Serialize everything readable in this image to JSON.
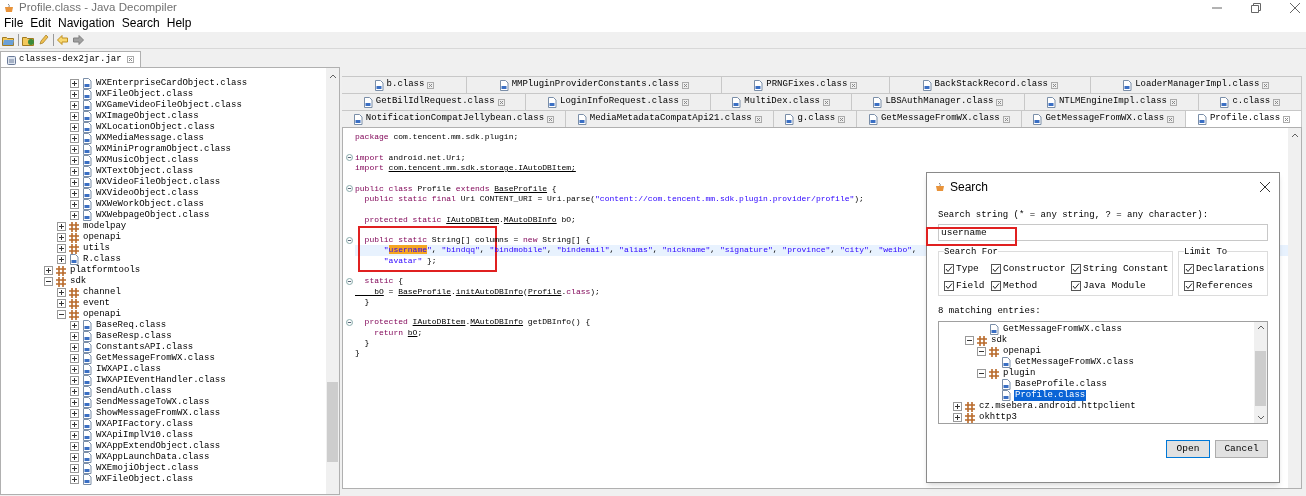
{
  "window": {
    "title": "Profile.class - Java Decompiler"
  },
  "menu": [
    "File",
    "Edit",
    "Navigation",
    "Search",
    "Help"
  ],
  "project_tab": {
    "label": "classes-dex2jar.jar",
    "selected": true
  },
  "project_tree": [
    {
      "children": [
        {
          "children": [
            {
              "label": "WXEnterpriseCardObject.class",
              "kind": "class",
              "expanded": false
            },
            {
              "label": "WXFileObject.class",
              "kind": "class",
              "expanded": false
            },
            {
              "label": "WXGameVideoFileObject.class",
              "kind": "class",
              "expanded": false
            },
            {
              "label": "WXImageObject.class",
              "kind": "class",
              "expanded": false
            },
            {
              "label": "WXLocationObject.class",
              "kind": "class",
              "expanded": false
            },
            {
              "label": "WXMediaMessage.class",
              "kind": "class",
              "expanded": false
            },
            {
              "label": "WXMiniProgramObject.class",
              "kind": "class",
              "expanded": false
            },
            {
              "label": "WXMusicObject.class",
              "kind": "class",
              "expanded": false
            },
            {
              "label": "WXTextObject.class",
              "kind": "class",
              "expanded": false
            },
            {
              "label": "WXVideoFileObject.class",
              "kind": "class",
              "expanded": false
            },
            {
              "label": "WXVideoObject.class",
              "kind": "class",
              "expanded": false
            },
            {
              "label": "WXWeWorkObject.class",
              "kind": "class",
              "expanded": false
            },
            {
              "label": "WXWebpageObject.class",
              "kind": "class",
              "expanded": false
            }
          ]
        },
        {
          "label": "modelpay",
          "kind": "package",
          "expanded": false
        },
        {
          "label": "openapi",
          "kind": "package",
          "expanded": false
        },
        {
          "label": "utils",
          "kind": "package",
          "expanded": false
        },
        {
          "label": "R.class",
          "kind": "class",
          "expanded": false
        }
      ]
    },
    {
      "label": "platformtools",
      "kind": "package",
      "expanded": false
    },
    {
      "label": "sdk",
      "kind": "package",
      "expanded": true,
      "children": [
        {
          "label": "channel",
          "kind": "package",
          "expanded": false
        },
        {
          "label": "event",
          "kind": "package",
          "expanded": false
        },
        {
          "label": "openapi",
          "kind": "package",
          "expanded": true,
          "children": [
            {
              "label": "BaseReq.class",
              "kind": "class",
              "expanded": false
            },
            {
              "label": "BaseResp.class",
              "kind": "class",
              "expanded": false
            },
            {
              "label": "ConstantsAPI.class",
              "kind": "class",
              "expanded": false
            },
            {
              "label": "GetMessageFromWX.class",
              "kind": "class",
              "expanded": false
            },
            {
              "label": "IWXAPI.class",
              "kind": "class",
              "expanded": false
            },
            {
              "label": "IWXAPIEventHandler.class",
              "kind": "class",
              "expanded": false
            },
            {
              "label": "SendAuth.class",
              "kind": "class",
              "expanded": false
            },
            {
              "label": "SendMessageToWX.class",
              "kind": "class",
              "expanded": false
            },
            {
              "label": "ShowMessageFromWX.class",
              "kind": "class",
              "expanded": false
            },
            {
              "label": "WXAPIFactory.class",
              "kind": "class",
              "expanded": false
            },
            {
              "label": "WXApiImplV10.class",
              "kind": "class",
              "expanded": false
            },
            {
              "label": "WXAppExtendObject.class",
              "kind": "class",
              "expanded": false
            },
            {
              "label": "WXAppLaunchData.class",
              "kind": "class",
              "expanded": false
            },
            {
              "label": "WXEmojiObject.class",
              "kind": "class",
              "expanded": false
            },
            {
              "label": "WXFileObject.class",
              "kind": "class",
              "expanded": false
            }
          ]
        }
      ]
    }
  ],
  "editor_tabs": [
    [
      {
        "label": "b.class",
        "selected": false
      },
      {
        "label": "MMPluginProviderConstants.class",
        "selected": false
      },
      {
        "label": "PRNGFixes.class",
        "selected": false
      },
      {
        "label": "BackStackRecord.class",
        "selected": false
      },
      {
        "label": "LoaderManagerImpl.class",
        "selected": false
      }
    ],
    [
      {
        "label": "GetBilIdlRequest.class",
        "selected": false
      },
      {
        "label": "LoginInfoRequest.class",
        "selected": false
      },
      {
        "label": "MultiDex.class",
        "selected": false
      },
      {
        "label": "LBSAuthManager.class",
        "selected": false
      },
      {
        "label": "NTLMEngineImpl.class",
        "selected": false
      },
      {
        "label": "c.class",
        "selected": false
      }
    ],
    [
      {
        "label": "NotificationCompatJellybean.class",
        "selected": false
      },
      {
        "label": "MediaMetadataCompatApi21.class",
        "selected": false
      },
      {
        "label": "g.class",
        "selected": false
      },
      {
        "label": "GetMessageFromWX.class",
        "selected": false
      },
      {
        "label": "GetMessageFromWX.class",
        "selected": false
      },
      {
        "label": "Profile.class",
        "selected": true
      }
    ]
  ],
  "code": [
    {
      "fold": false,
      "current": false,
      "segments": [
        {
          "text": "package",
          "kind": "kw"
        },
        {
          "text": " com.tencent.mm.sdk.plugin;",
          "kind": "txt"
        }
      ]
    },
    {
      "fold": false,
      "current": false
    },
    {
      "fold": true,
      "current": false,
      "segments": [
        {
          "text": "import",
          "kind": "kw"
        },
        {
          "text": " android.net.Uri;",
          "kind": "txt"
        }
      ]
    },
    {
      "fold": false,
      "current": false,
      "segments": [
        {
          "text": "import ",
          "kind": "kw"
        },
        {
          "text": "com.tencent.mm.sdk.storage.IAutoDBItem;",
          "kind": "ref"
        }
      ]
    },
    {
      "fold": false,
      "current": false
    },
    {
      "fold": true,
      "current": false,
      "segments": [
        {
          "text": "public class",
          "kind": "kw"
        },
        {
          "text": " Profile ",
          "kind": "txt"
        },
        {
          "text": "extends ",
          "kind": "kw"
        },
        {
          "text": "BaseProfile",
          "kind": "ref"
        },
        {
          "text": " {",
          "kind": "txt"
        }
      ]
    },
    {
      "fold": false,
      "current": false,
      "segments": [
        {
          "text": "  public static final",
          "kind": "kw"
        },
        {
          "text": " Uri CONTENT_URI = Uri.parse(",
          "kind": "txt"
        },
        {
          "text": "\"content://com.tencent.mm.sdk.plugin.provider/profile\"",
          "kind": "str"
        },
        {
          "text": ");",
          "kind": "txt"
        }
      ]
    },
    {
      "fold": false,
      "current": false
    },
    {
      "fold": false,
      "current": false,
      "segments": [
        {
          "text": "  protected static ",
          "kind": "kw"
        },
        {
          "text": "IAutoDBItem",
          "kind": "ref"
        },
        {
          "text": ".",
          "kind": "txt"
        },
        {
          "text": "MAutoDBInfo",
          "kind": "ref"
        },
        {
          "text": " bO;",
          "kind": "txt"
        }
      ]
    },
    {
      "fold": false,
      "current": false
    },
    {
      "fold": true,
      "current": false,
      "segments": [
        {
          "text": "  public static",
          "kind": "kw"
        },
        {
          "text": " String[] columns = ",
          "kind": "txt"
        },
        {
          "text": "new",
          "kind": "kw"
        },
        {
          "text": " String[] {",
          "kind": "txt"
        }
      ]
    },
    {
      "fold": false,
      "current": true,
      "segments": [
        {
          "text": "      \"",
          "kind": "str"
        },
        {
          "text": "username",
          "kind": "match"
        },
        {
          "text": "\"",
          "kind": "str"
        },
        {
          "text": ", ",
          "kind": "txt"
        },
        {
          "text": "\"bindqq\"",
          "kind": "str"
        },
        {
          "text": ", ",
          "kind": "txt"
        },
        {
          "text": "\"bindmobile\"",
          "kind": "str"
        },
        {
          "text": ", ",
          "kind": "txt"
        },
        {
          "text": "\"bindemail\"",
          "kind": "str"
        },
        {
          "text": ", ",
          "kind": "txt"
        },
        {
          "text": "\"alias\"",
          "kind": "str"
        },
        {
          "text": ", ",
          "kind": "txt"
        },
        {
          "text": "\"nickname\"",
          "kind": "str"
        },
        {
          "text": ", ",
          "kind": "txt"
        },
        {
          "text": "\"signature\"",
          "kind": "str"
        },
        {
          "text": ", ",
          "kind": "txt"
        },
        {
          "text": "\"province\"",
          "kind": "str"
        },
        {
          "text": ", ",
          "kind": "txt"
        },
        {
          "text": "\"city\"",
          "kind": "str"
        },
        {
          "text": ", ",
          "kind": "txt"
        },
        {
          "text": "\"weibo\"",
          "kind": "str"
        },
        {
          "text": ",",
          "kind": "txt"
        }
      ]
    },
    {
      "fold": false,
      "current": false,
      "segments": [
        {
          "text": "      \"avatar\"",
          "kind": "str"
        },
        {
          "text": " };",
          "kind": "txt"
        }
      ]
    },
    {
      "fold": false,
      "current": false
    },
    {
      "fold": true,
      "current": false,
      "segments": [
        {
          "text": "  static",
          "kind": "kw"
        },
        {
          "text": " {",
          "kind": "txt"
        }
      ]
    },
    {
      "fold": false,
      "current": false,
      "segments": [
        {
          "text": "    bO",
          "kind": "ref"
        },
        {
          "text": " = ",
          "kind": "txt"
        },
        {
          "text": "BaseProfile",
          "kind": "ref"
        },
        {
          "text": ".",
          "kind": "txt"
        },
        {
          "text": "initAutoDBInfo",
          "kind": "ref"
        },
        {
          "text": "(",
          "kind": "txt"
        },
        {
          "text": "Profile",
          "kind": "ref"
        },
        {
          "text": ".",
          "kind": "txt"
        },
        {
          "text": "class",
          "kind": "kw"
        },
        {
          "text": ");",
          "kind": "txt"
        }
      ]
    },
    {
      "fold": false,
      "current": false,
      "segments": [
        {
          "text": "  }",
          "kind": "txt"
        }
      ]
    },
    {
      "fold": false,
      "current": false
    },
    {
      "fold": true,
      "current": false,
      "segments": [
        {
          "text": "  protected ",
          "kind": "kw"
        },
        {
          "text": "IAutoDBItem",
          "kind": "ref"
        },
        {
          "text": ".",
          "kind": "txt"
        },
        {
          "text": "MAutoDBInfo",
          "kind": "ref"
        },
        {
          "text": " getDBInfo() {",
          "kind": "txt"
        }
      ]
    },
    {
      "fold": false,
      "current": false,
      "segments": [
        {
          "text": "    return ",
          "kind": "kw"
        },
        {
          "text": "bO",
          "kind": "ref"
        },
        {
          "text": ";",
          "kind": "txt"
        }
      ]
    },
    {
      "fold": false,
      "current": false,
      "segments": [
        {
          "text": "  }",
          "kind": "txt"
        }
      ]
    },
    {
      "fold": false,
      "current": false,
      "segments": [
        {
          "text": "}",
          "kind": "txt"
        }
      ]
    }
  ],
  "search_dialog": {
    "title": "Search",
    "prompt": "Search string (* = any string, ? = any character):",
    "value": "username",
    "search_for": {
      "title": "Search For",
      "options": [
        {
          "label": "Type",
          "checked": true
        },
        {
          "label": "Constructor",
          "checked": true
        },
        {
          "label": "String Constant",
          "checked": true
        },
        {
          "label": "Field",
          "checked": true
        },
        {
          "label": "Method",
          "checked": true
        },
        {
          "label": "Java Module",
          "checked": true
        }
      ]
    },
    "limit_to": {
      "title": "Limit To",
      "options": [
        {
          "label": "Declarations",
          "checked": true
        },
        {
          "label": "References",
          "checked": true
        }
      ]
    },
    "results_label": "8 matching entries:",
    "results": [
      {
        "children": [
          {
            "children": [
              {
                "label": "GetMessageFromWX.class",
                "kind": "class",
                "selected": false
              }
            ]
          },
          {
            "label": "sdk",
            "kind": "package",
            "expanded": true,
            "selected": false,
            "children": [
              {
                "label": "openapi",
                "kind": "package",
                "expanded": true,
                "selected": false,
                "children": [
                  {
                    "label": "GetMessageFromWX.class",
                    "kind": "class",
                    "selected": false
                  }
                ]
              },
              {
                "label": "plugin",
                "kind": "package",
                "expanded": true,
                "selected": false,
                "children": [
                  {
                    "label": "BaseProfile.class",
                    "kind": "class",
                    "selected": false
                  },
                  {
                    "label": "Profile.class",
                    "kind": "class",
                    "selected": true
                  }
                ]
              }
            ]
          }
        ]
      },
      {
        "label": "cz.msebera.android.httpclient",
        "kind": "package",
        "expanded": false,
        "selected": false
      },
      {
        "label": "okhttp3",
        "kind": "package",
        "expanded": false,
        "selected": false
      }
    ],
    "buttons": [
      {
        "label": "Open",
        "default": true
      },
      {
        "label": "Cancel",
        "default": false
      }
    ]
  }
}
